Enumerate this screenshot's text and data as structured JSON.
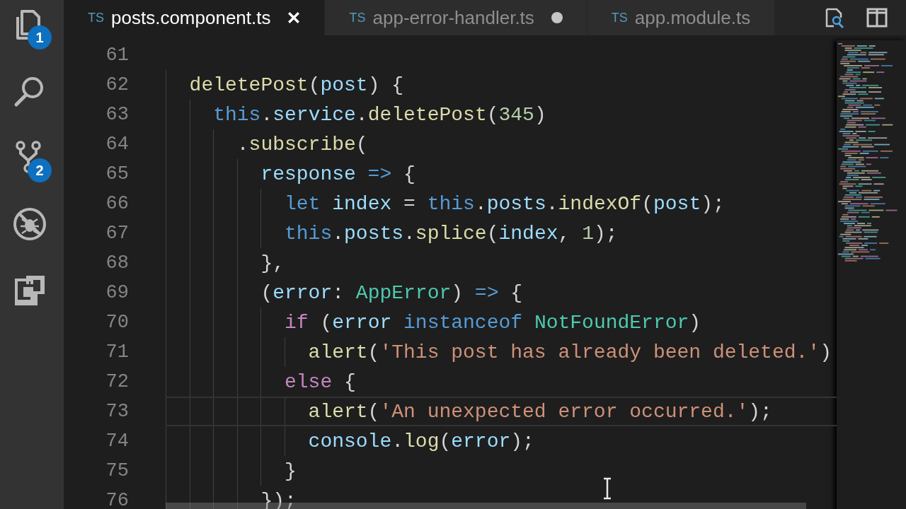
{
  "activity_bar": [
    {
      "kind": "explorer",
      "badge": "1"
    },
    {
      "kind": "search"
    },
    {
      "kind": "source-control",
      "badge": "2"
    },
    {
      "kind": "debug"
    },
    {
      "kind": "extensions"
    }
  ],
  "tabs": [
    {
      "lang": "TS",
      "label": "posts.component.ts",
      "selected": true,
      "modified": false
    },
    {
      "lang": "TS",
      "label": "app-error-handler.ts",
      "selected": false,
      "modified": true
    },
    {
      "lang": "TS",
      "label": "app.module.ts",
      "selected": false,
      "modified": false
    }
  ],
  "editor": {
    "lines": [
      {
        "number": "61",
        "current": false
      },
      {
        "number": "62",
        "current": false,
        "tokens": [
          {
            "kind": "fn",
            "text": "  deletePost"
          },
          {
            "kind": "p",
            "text": "("
          },
          {
            "kind": "var",
            "text": "post"
          },
          {
            "kind": "p",
            "text": ") {"
          }
        ]
      },
      {
        "number": "63",
        "current": false,
        "tokens": [
          {
            "kind": "kw",
            "text": "    this"
          },
          {
            "kind": "p",
            "text": "."
          },
          {
            "kind": "var",
            "text": "service"
          },
          {
            "kind": "p",
            "text": "."
          },
          {
            "kind": "fn",
            "text": "deletePost"
          },
          {
            "kind": "p",
            "text": "("
          },
          {
            "kind": "num",
            "text": "345"
          },
          {
            "kind": "p",
            "text": ")"
          }
        ]
      },
      {
        "number": "64",
        "current": false,
        "tokens": [
          {
            "kind": "p",
            "text": "      ."
          },
          {
            "kind": "fn",
            "text": "subscribe"
          },
          {
            "kind": "p",
            "text": "("
          }
        ]
      },
      {
        "number": "65",
        "current": false,
        "tokens": [
          {
            "kind": "var",
            "text": "        response"
          },
          {
            "kind": "kw",
            "text": " =>"
          },
          {
            "kind": "p",
            "text": " {"
          }
        ]
      },
      {
        "number": "66",
        "current": false,
        "tokens": [
          {
            "kind": "kw",
            "text": "          let"
          },
          {
            "kind": "var",
            "text": " index"
          },
          {
            "kind": "p",
            "text": " = "
          },
          {
            "kind": "kw",
            "text": "this"
          },
          {
            "kind": "p",
            "text": "."
          },
          {
            "kind": "var",
            "text": "posts"
          },
          {
            "kind": "p",
            "text": "."
          },
          {
            "kind": "fn",
            "text": "indexOf"
          },
          {
            "kind": "p",
            "text": "("
          },
          {
            "kind": "var",
            "text": "post"
          },
          {
            "kind": "p",
            "text": ");"
          }
        ]
      },
      {
        "number": "67",
        "current": false,
        "tokens": [
          {
            "kind": "kw",
            "text": "          this"
          },
          {
            "kind": "p",
            "text": "."
          },
          {
            "kind": "var",
            "text": "posts"
          },
          {
            "kind": "p",
            "text": "."
          },
          {
            "kind": "fn",
            "text": "splice"
          },
          {
            "kind": "p",
            "text": "("
          },
          {
            "kind": "var",
            "text": "index"
          },
          {
            "kind": "p",
            "text": ", "
          },
          {
            "kind": "num",
            "text": "1"
          },
          {
            "kind": "p",
            "text": ");"
          }
        ]
      },
      {
        "number": "68",
        "current": false,
        "tokens": [
          {
            "kind": "p",
            "text": "        },"
          }
        ]
      },
      {
        "number": "69",
        "current": false,
        "tokens": [
          {
            "kind": "p",
            "text": "        ("
          },
          {
            "kind": "var",
            "text": "error"
          },
          {
            "kind": "p",
            "text": ": "
          },
          {
            "kind": "type",
            "text": "AppError"
          },
          {
            "kind": "p",
            "text": ") "
          },
          {
            "kind": "kw",
            "text": "=>"
          },
          {
            "kind": "p",
            "text": " {"
          }
        ]
      },
      {
        "number": "70",
        "current": false,
        "tokens": [
          {
            "kind": "ctl",
            "text": "          if"
          },
          {
            "kind": "p",
            "text": " ("
          },
          {
            "kind": "var",
            "text": "error"
          },
          {
            "kind": "kw",
            "text": " instanceof"
          },
          {
            "kind": "type",
            "text": " NotFoundError"
          },
          {
            "kind": "p",
            "text": ")"
          }
        ]
      },
      {
        "number": "71",
        "current": false,
        "tokens": [
          {
            "kind": "fn",
            "text": "            alert"
          },
          {
            "kind": "p",
            "text": "("
          },
          {
            "kind": "str",
            "text": "'This post has already been deleted.'"
          },
          {
            "kind": "p",
            "text": ")"
          }
        ]
      },
      {
        "number": "72",
        "current": false,
        "tokens": [
          {
            "kind": "ctl",
            "text": "          else"
          },
          {
            "kind": "p",
            "text": " {"
          }
        ]
      },
      {
        "number": "73",
        "current": true,
        "tokens": [
          {
            "kind": "fn",
            "text": "            alert"
          },
          {
            "kind": "p",
            "text": "("
          },
          {
            "kind": "str",
            "text": "'An unexpected error occurred.'"
          },
          {
            "kind": "p",
            "text": ");"
          }
        ]
      },
      {
        "number": "74",
        "current": false,
        "tokens": [
          {
            "kind": "var",
            "text": "            console"
          },
          {
            "kind": "p",
            "text": "."
          },
          {
            "kind": "fn",
            "text": "log"
          },
          {
            "kind": "p",
            "text": "("
          },
          {
            "kind": "var",
            "text": "error"
          },
          {
            "kind": "p",
            "text": ");"
          }
        ]
      },
      {
        "number": "75",
        "current": false,
        "tokens": [
          {
            "kind": "p",
            "text": "          }"
          }
        ]
      },
      {
        "number": "76",
        "current": false,
        "tokens": [
          {
            "kind": "p",
            "text": "        });"
          }
        ]
      }
    ]
  }
}
